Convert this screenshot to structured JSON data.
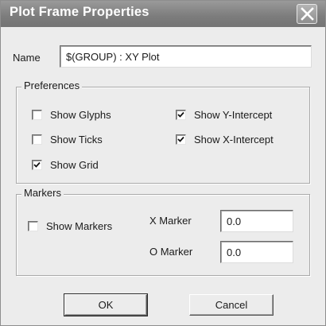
{
  "window": {
    "title": "Plot Frame Properties"
  },
  "name_field": {
    "label": "Name",
    "value": "$(GROUP) : XY Plot"
  },
  "preferences": {
    "legend": "Preferences",
    "options": [
      {
        "label": "Show Glyphs",
        "checked": false
      },
      {
        "label": "Show Ticks",
        "checked": false
      },
      {
        "label": "Show Grid",
        "checked": true
      },
      {
        "label": "Show Y-Intercept",
        "checked": true
      },
      {
        "label": "Show X-Intercept",
        "checked": true
      }
    ]
  },
  "markers": {
    "legend": "Markers",
    "show_markers": {
      "label": "Show Markers",
      "checked": false
    },
    "x_marker": {
      "label": "X Marker",
      "value": "0.0"
    },
    "o_marker": {
      "label": "O Marker",
      "value": "0.0"
    }
  },
  "buttons": {
    "ok": "OK",
    "cancel": "Cancel"
  },
  "colors": {
    "titlebar": "#858585",
    "dialog_bg": "#ececec"
  }
}
